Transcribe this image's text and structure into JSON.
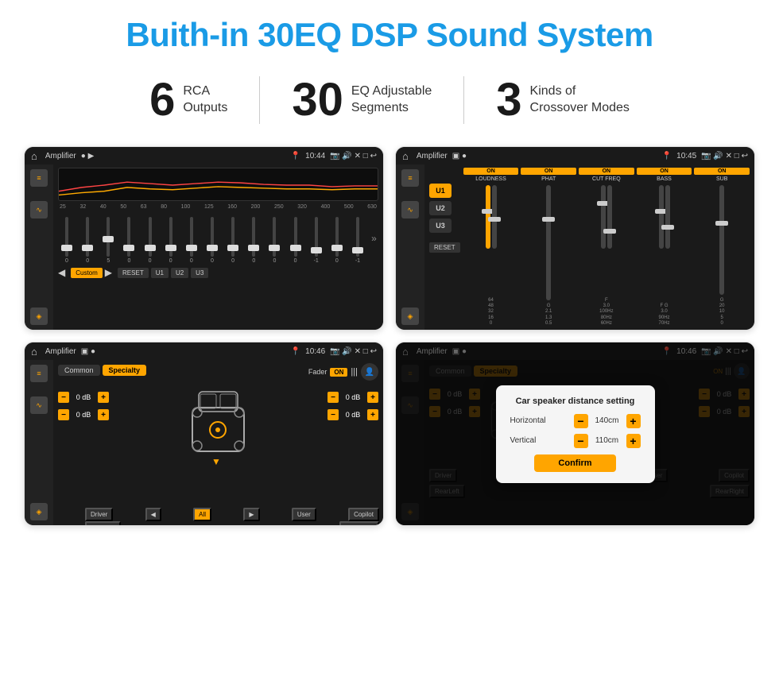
{
  "page": {
    "title": "Buith-in 30EQ DSP Sound System",
    "stats": [
      {
        "number": "6",
        "label": "RCA\nOutputs"
      },
      {
        "number": "30",
        "label": "EQ Adjustable\nSegments"
      },
      {
        "number": "3",
        "label": "Kinds of\nCrossover Modes"
      }
    ],
    "screens": [
      {
        "id": "eq-screen",
        "status_bar": {
          "app_name": "Amplifier",
          "time": "10:44",
          "icons": [
            "●",
            "▶"
          ]
        },
        "type": "eq"
      },
      {
        "id": "amp-screen",
        "status_bar": {
          "app_name": "Amplifier",
          "time": "10:45",
          "icons": [
            "▣",
            "●"
          ]
        },
        "type": "amp"
      },
      {
        "id": "speaker-screen",
        "status_bar": {
          "app_name": "Amplifier",
          "time": "10:46",
          "icons": [
            "▣",
            "●"
          ]
        },
        "type": "speaker"
      },
      {
        "id": "dialog-screen",
        "status_bar": {
          "app_name": "Amplifier",
          "time": "10:46",
          "icons": [
            "▣",
            "●"
          ]
        },
        "type": "dialog"
      }
    ],
    "eq": {
      "frequencies": [
        "25",
        "32",
        "40",
        "50",
        "63",
        "80",
        "100",
        "125",
        "160",
        "200",
        "250",
        "320",
        "400",
        "500",
        "630"
      ],
      "presets": [
        "Custom"
      ],
      "buttons": [
        "◀",
        "Custom",
        "▶",
        "RESET",
        "U1",
        "U2",
        "U3"
      ]
    },
    "amp": {
      "presets": [
        "U1",
        "U2",
        "U3"
      ],
      "bands": [
        "LOUDNESS",
        "PHAT",
        "CUT FREQ",
        "BASS",
        "SUB"
      ],
      "reset": "RESET"
    },
    "speaker": {
      "tabs": [
        "Common",
        "Specialty"
      ],
      "fader_label": "Fader",
      "fader_on": "ON",
      "volumes": [
        "0 dB",
        "0 dB",
        "0 dB",
        "0 dB"
      ],
      "bottom_buttons": [
        "Driver",
        "◀",
        "All",
        "▶",
        "User",
        "Copilot",
        "RearLeft",
        "RearRight"
      ]
    },
    "dialog": {
      "title": "Car speaker distance setting",
      "horizontal_label": "Horizontal",
      "horizontal_value": "140cm",
      "vertical_label": "Vertical",
      "vertical_value": "110cm",
      "confirm_label": "Confirm",
      "db_values": [
        "0 dB",
        "0 dB"
      ]
    }
  }
}
